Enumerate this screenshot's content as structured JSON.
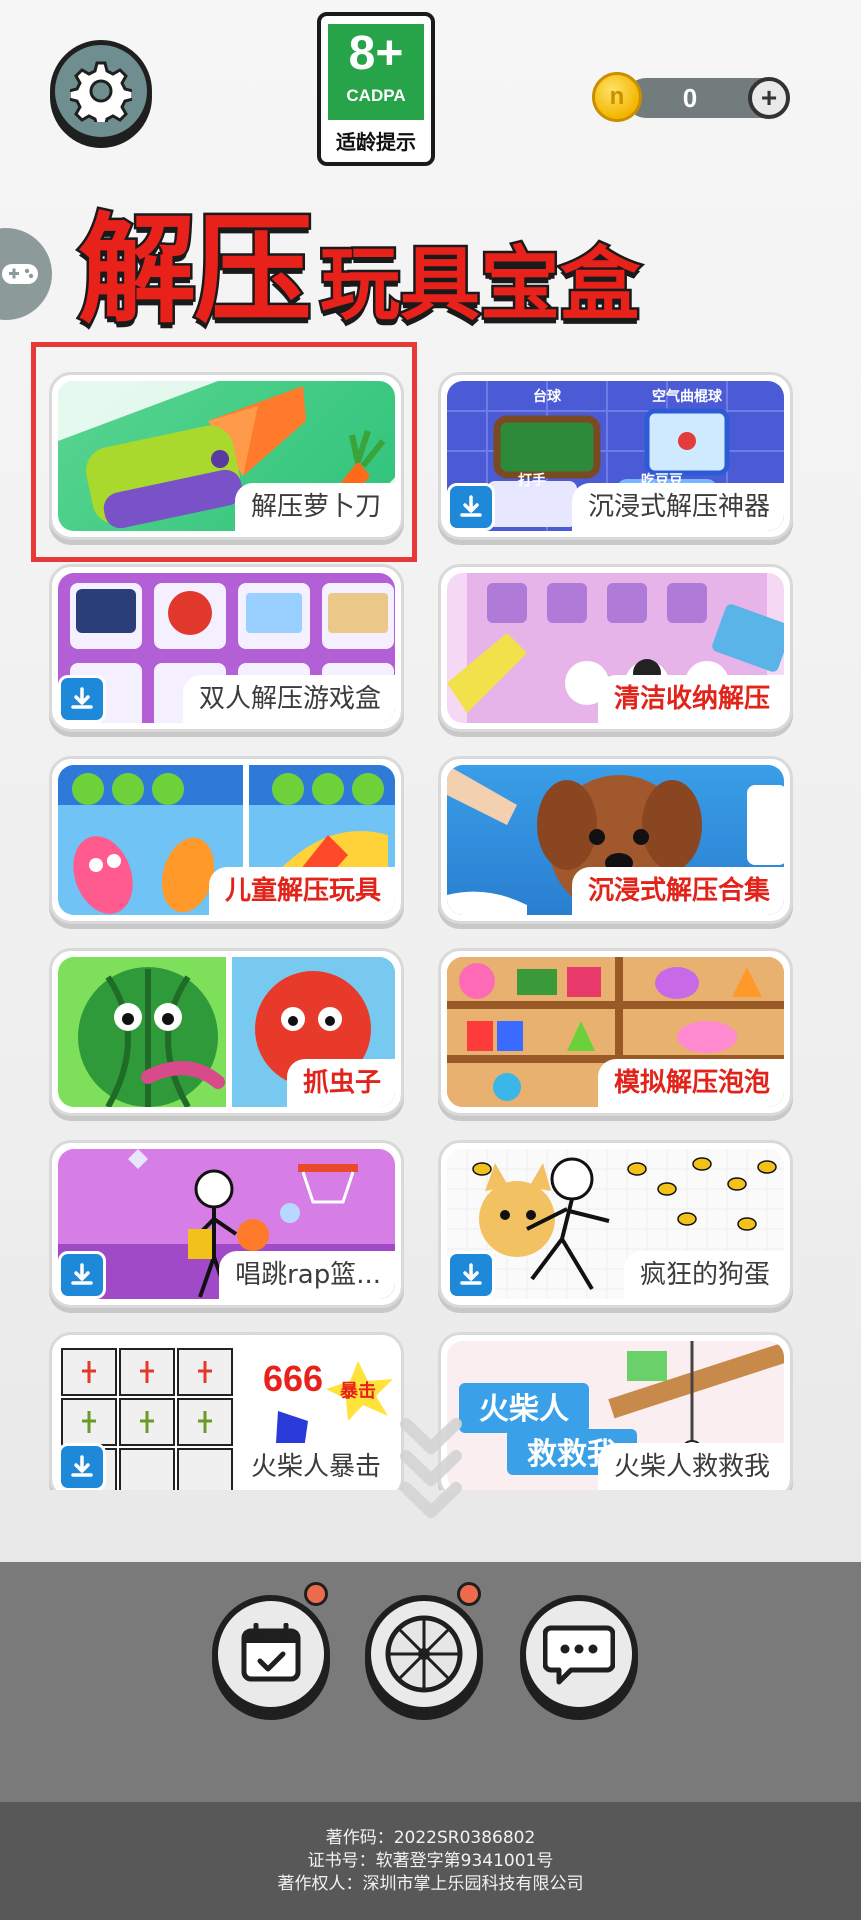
{
  "age_rating": {
    "number": "8+",
    "org": "CADPA",
    "tip": "适龄提示"
  },
  "coins": {
    "icon_letter": "n",
    "count": "0",
    "add_symbol": "+"
  },
  "title": {
    "big": "解压",
    "small": "玩具宝盒"
  },
  "games": [
    {
      "label": "解压萝卜刀",
      "download": false,
      "highlighted": true,
      "label_style": "normal"
    },
    {
      "label": "沉浸式解压神器",
      "download": true,
      "label_style": "normal"
    },
    {
      "label": "双人解压游戏盒",
      "download": true,
      "label_style": "normal"
    },
    {
      "label": "清洁收纳解压",
      "download": false,
      "label_style": "red"
    },
    {
      "label": "儿童解压玩具",
      "download": false,
      "label_style": "red"
    },
    {
      "label": "沉浸式解压合集",
      "download": false,
      "label_style": "red"
    },
    {
      "label": "抓虫子",
      "download": false,
      "label_style": "red"
    },
    {
      "label": "模拟解压泡泡",
      "download": false,
      "label_style": "red"
    },
    {
      "label": "唱跳rap篮...",
      "download": true,
      "label_style": "normal"
    },
    {
      "label": "疯狂的狗蛋",
      "download": true,
      "label_style": "normal"
    },
    {
      "label": "火柴人暴击",
      "download": true,
      "label_style": "normal"
    },
    {
      "label": "火柴人救救我",
      "download": false,
      "label_style": "normal"
    }
  ],
  "card_art_text": {
    "pool": "台球",
    "air_hockey": "空气曲棍球",
    "hit": "打手",
    "eat_beans": "吃豆豆",
    "num_666": "666",
    "crit": "暴击",
    "rescue_1": "火柴人",
    "rescue_2": "救救我"
  },
  "bottom_buttons": [
    {
      "name": "daily-checkin",
      "icon": "calendar-check-icon",
      "badge": true
    },
    {
      "name": "lucky-wheel",
      "icon": "wheel-icon",
      "badge": true
    },
    {
      "name": "more",
      "icon": "chat-bubble-icon",
      "badge": false
    }
  ],
  "footer": {
    "line1": "著作码：2022SR0386802",
    "line2": "证书号：软著登字第9341001号",
    "line3": "著作权人：深圳市掌上乐园科技有限公司"
  },
  "colors": {
    "title_red": "#e8211b",
    "download_blue": "#1e88d9",
    "highlight_red": "#e63a3a",
    "cadpa_green": "#27a44a"
  }
}
